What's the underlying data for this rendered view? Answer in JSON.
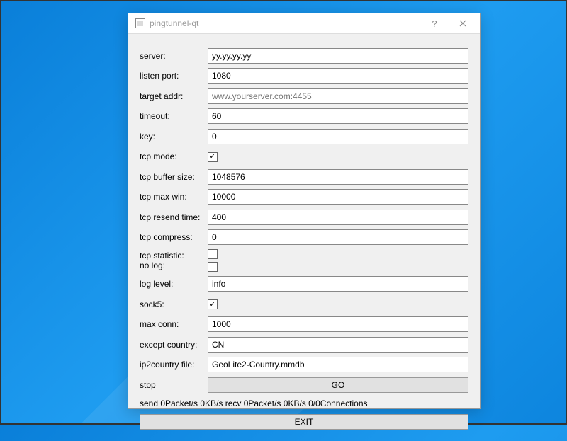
{
  "window": {
    "title": "pingtunnel-qt"
  },
  "form": {
    "server": {
      "label": "server:",
      "value": "yy.yy.yy.yy"
    },
    "listen_port": {
      "label": "listen port:",
      "value": "1080"
    },
    "target_addr": {
      "label": "target addr:",
      "placeholder": "www.yourserver.com:4455"
    },
    "timeout": {
      "label": "timeout:",
      "value": "60"
    },
    "key": {
      "label": "key:",
      "value": "0"
    },
    "tcp_mode": {
      "label": "tcp mode:",
      "checked": true
    },
    "tcp_buffer_size": {
      "label": "tcp buffer size:",
      "value": "1048576"
    },
    "tcp_max_win": {
      "label": "tcp max win:",
      "value": "10000"
    },
    "tcp_resend_time": {
      "label": "tcp resend time:",
      "value": "400"
    },
    "tcp_compress": {
      "label": "tcp compress:",
      "value": "0"
    },
    "tcp_statistic": {
      "label": "tcp statistic:",
      "checked": false
    },
    "no_log": {
      "label": "no log:",
      "checked": false
    },
    "log_level": {
      "label": "log level:",
      "value": "info"
    },
    "sock5": {
      "label": "sock5:",
      "checked": true
    },
    "max_conn": {
      "label": "max conn:",
      "value": "1000"
    },
    "except_country": {
      "label": "except country:",
      "value": "CN"
    },
    "ip2country_file": {
      "label": "ip2country file:",
      "value": "GeoLite2-Country.mmdb"
    }
  },
  "status": {
    "stop_label": "stop",
    "go_button": "GO",
    "line": "send 0Packet/s 0KB/s recv 0Packet/s 0KB/s 0/0Connections",
    "exit_button": "EXIT"
  }
}
